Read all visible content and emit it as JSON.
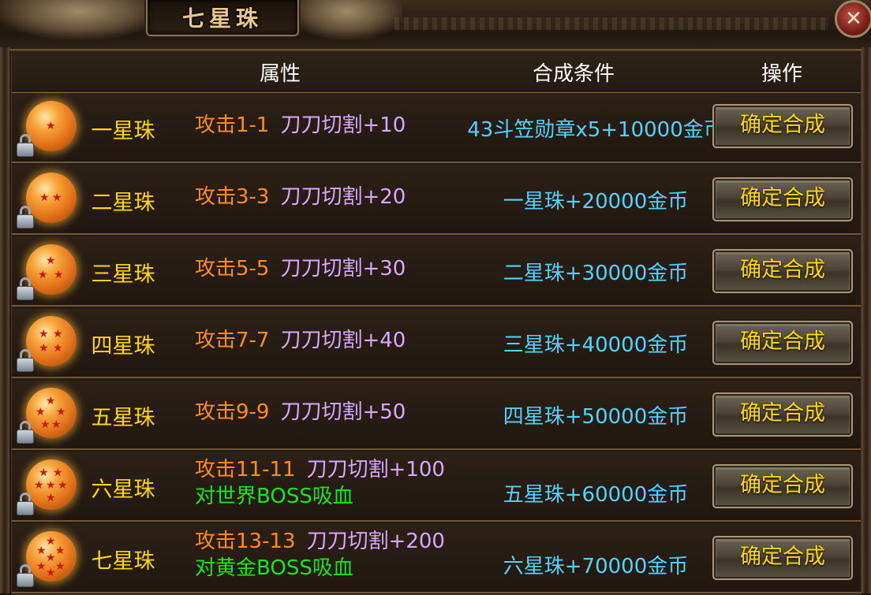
{
  "window": {
    "title": "七星珠",
    "close_icon": "close-icon"
  },
  "table": {
    "headers": {
      "attribute": "属性",
      "condition": "合成条件",
      "operation": "操作"
    },
    "rows": [
      {
        "name": "一星珠",
        "stars": 1,
        "attack": "攻击1-1",
        "skill": "刀刀切割+10",
        "boss": "",
        "condition": "43斗笠勋章x5+10000金币",
        "button": "确定合成"
      },
      {
        "name": "二星珠",
        "stars": 2,
        "attack": "攻击3-3",
        "skill": "刀刀切割+20",
        "boss": "",
        "condition": "一星珠+20000金币",
        "button": "确定合成"
      },
      {
        "name": "三星珠",
        "stars": 3,
        "attack": "攻击5-5",
        "skill": "刀刀切割+30",
        "boss": "",
        "condition": "二星珠+30000金币",
        "button": "确定合成"
      },
      {
        "name": "四星珠",
        "stars": 4,
        "attack": "攻击7-7",
        "skill": "刀刀切割+40",
        "boss": "",
        "condition": "三星珠+40000金币",
        "button": "确定合成"
      },
      {
        "name": "五星珠",
        "stars": 5,
        "attack": "攻击9-9",
        "skill": "刀刀切割+50",
        "boss": "",
        "condition": "四星珠+50000金币",
        "button": "确定合成"
      },
      {
        "name": "六星珠",
        "stars": 6,
        "attack": "攻击11-11",
        "skill": "刀刀切割+100",
        "boss": "对世界BOSS吸血",
        "condition": "五星珠+60000金币",
        "button": "确定合成"
      },
      {
        "name": "七星珠",
        "stars": 7,
        "attack": "攻击13-13",
        "skill": "刀刀切割+200",
        "boss": "对黄金BOSS吸血",
        "condition": "六星珠+70000金币",
        "button": "确定合成"
      }
    ]
  },
  "colors": {
    "name": "#ffd800",
    "attack": "#ff8c1a",
    "skill": "#d9a6ff",
    "boss": "#19e619",
    "condition": "#4fd4ff",
    "button_text": "#ffd800"
  }
}
